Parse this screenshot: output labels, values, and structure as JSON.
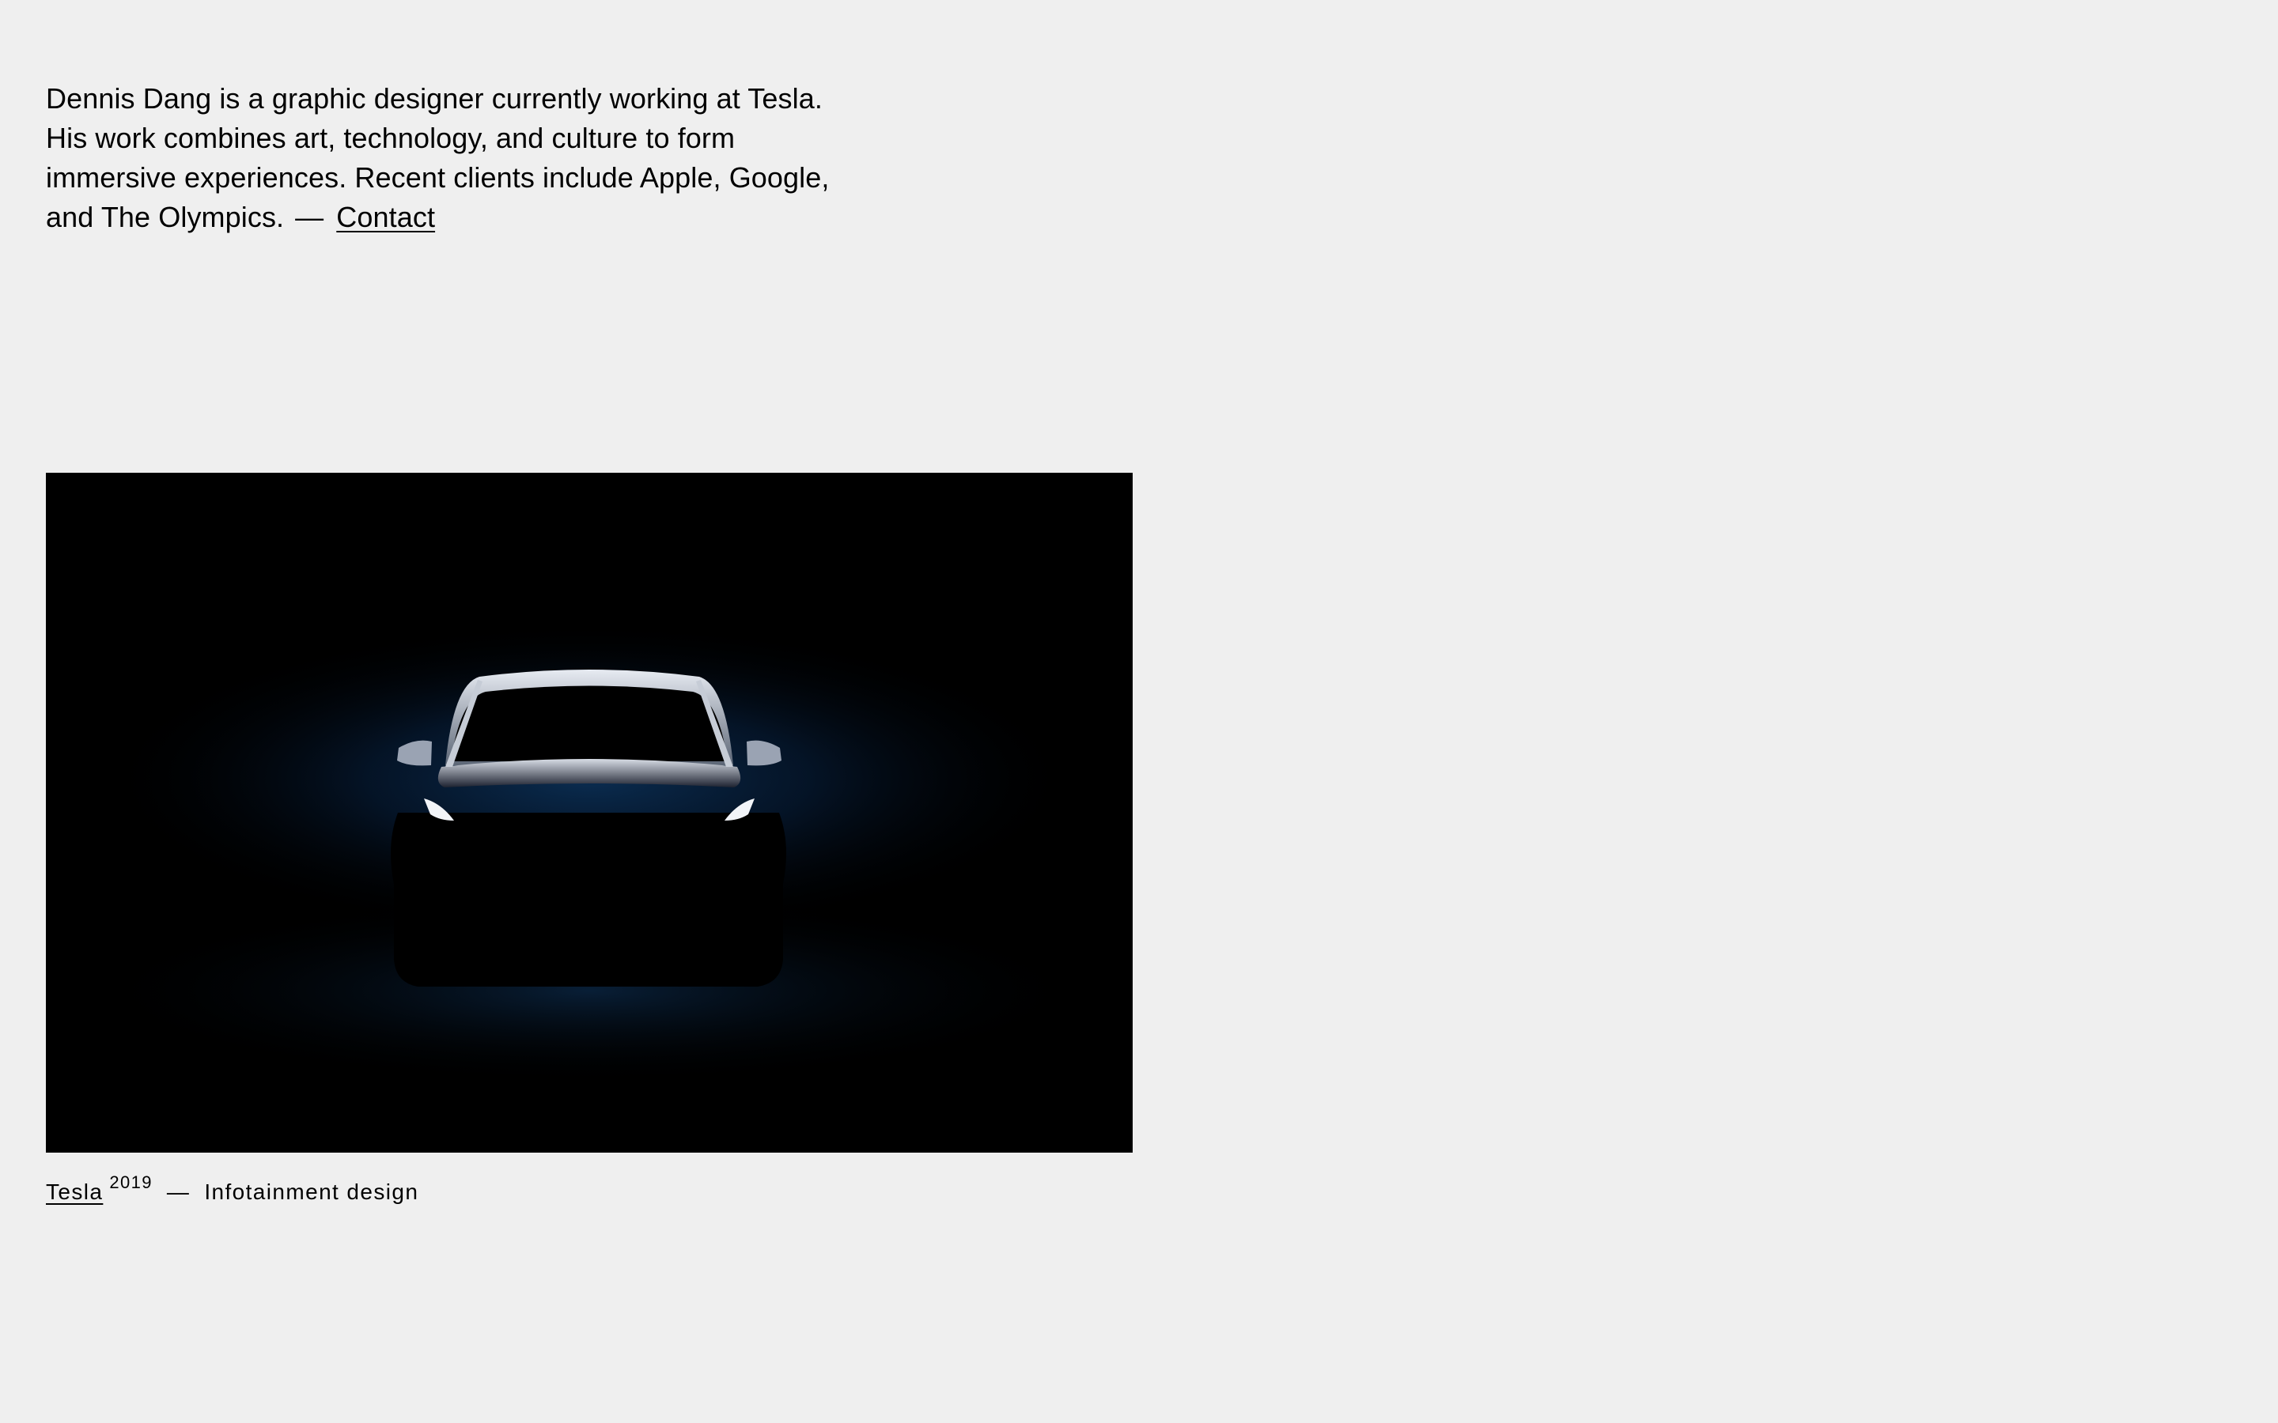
{
  "intro": {
    "text": "Dennis Dang is a graphic designer currently working at Tesla. His work combines art, technology, and culture to form immersive experiences. Recent clients include Apple, Google, and The Olympics.",
    "separator": "—",
    "contact_label": "Contact"
  },
  "project": {
    "image_icon": "car-silhouette-icon",
    "client_label": "Tesla",
    "year": "2019",
    "separator": "—",
    "description": "Infotainment design"
  },
  "colors": {
    "background": "#efefef",
    "text": "#000000",
    "image_background": "#000000",
    "glow": "#0b2f55"
  }
}
